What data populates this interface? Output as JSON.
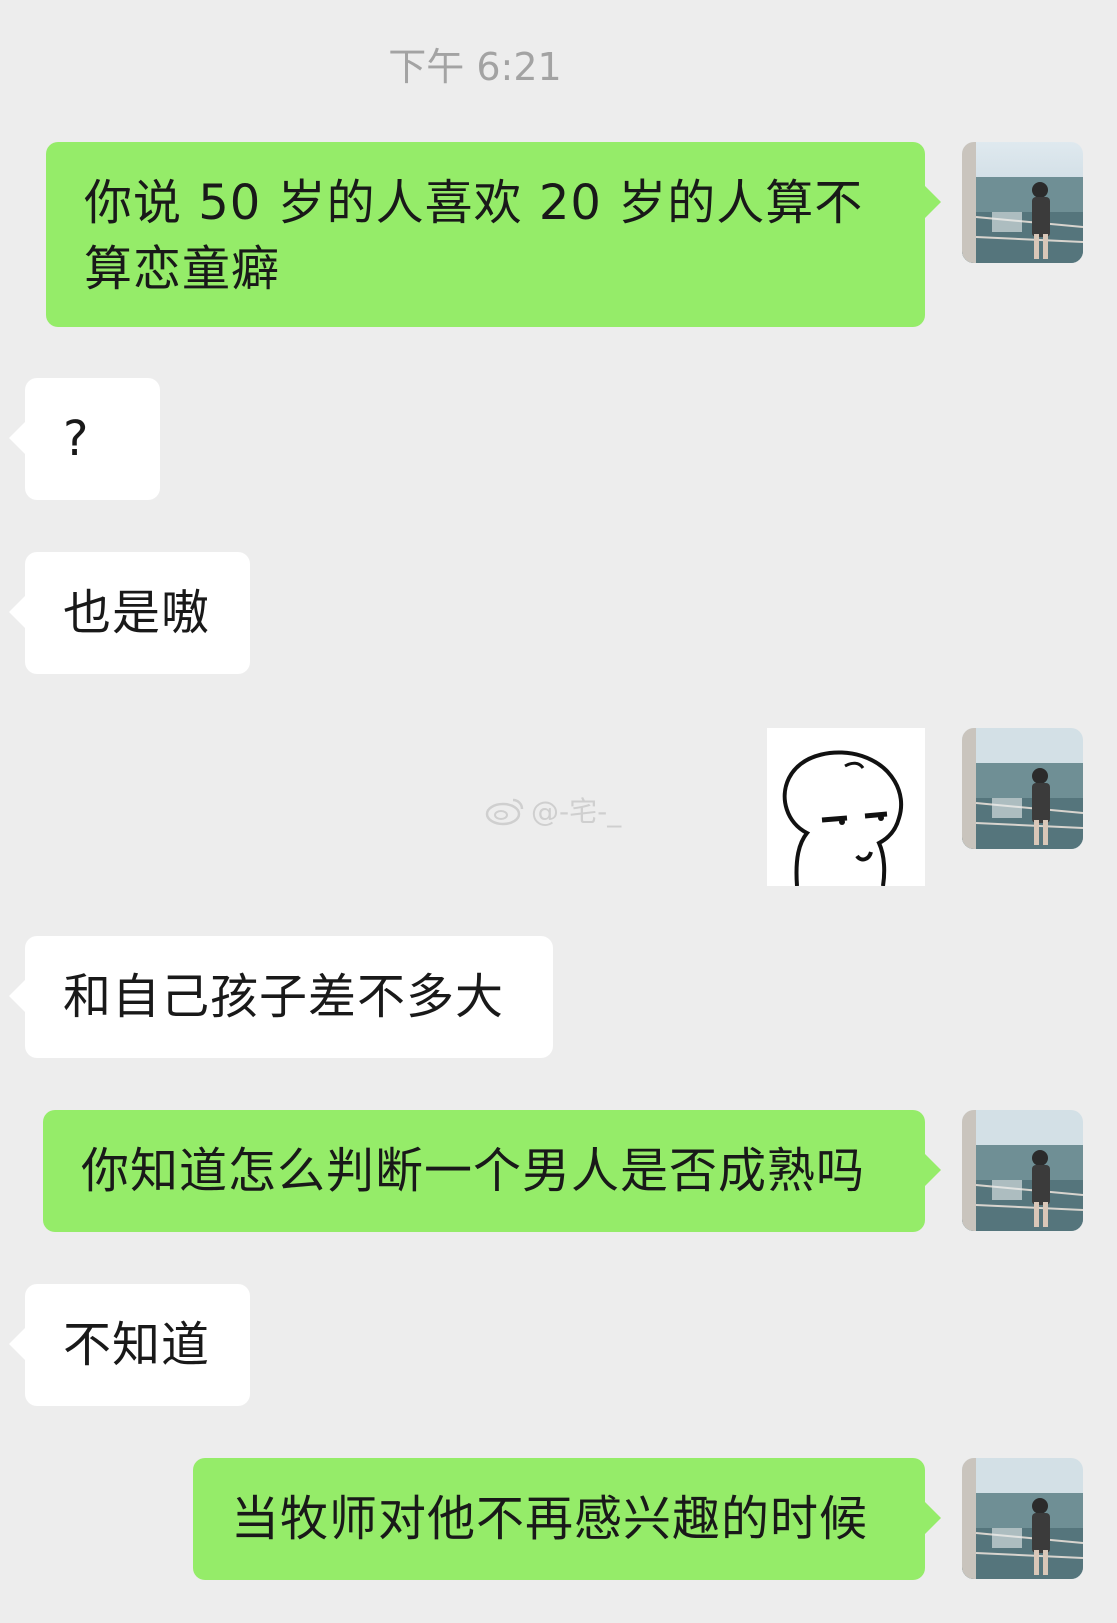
{
  "chat": {
    "timestamp": "下午 6:21",
    "messages": [
      {
        "direction": "out",
        "text": "你说 50 岁的人喜欢 20 岁的人算不算恋童癖"
      },
      {
        "direction": "in",
        "text": "?"
      },
      {
        "direction": "in",
        "text": "也是嗷"
      },
      {
        "direction": "out",
        "type": "sticker",
        "icon": "smirk-face-sticker-icon"
      },
      {
        "direction": "in",
        "text": "和自己孩子差不多大"
      },
      {
        "direction": "out",
        "text": "你知道怎么判断一个男人是否成熟吗"
      },
      {
        "direction": "in",
        "text": "不知道"
      },
      {
        "direction": "out",
        "text": "当牧师对他不再感兴趣的时候"
      }
    ]
  },
  "watermark": {
    "text": "@-宅-_",
    "icon": "weibo-icon"
  },
  "colors": {
    "background": "#ededed",
    "outgoing": "#95ec69",
    "incoming": "#ffffff"
  }
}
